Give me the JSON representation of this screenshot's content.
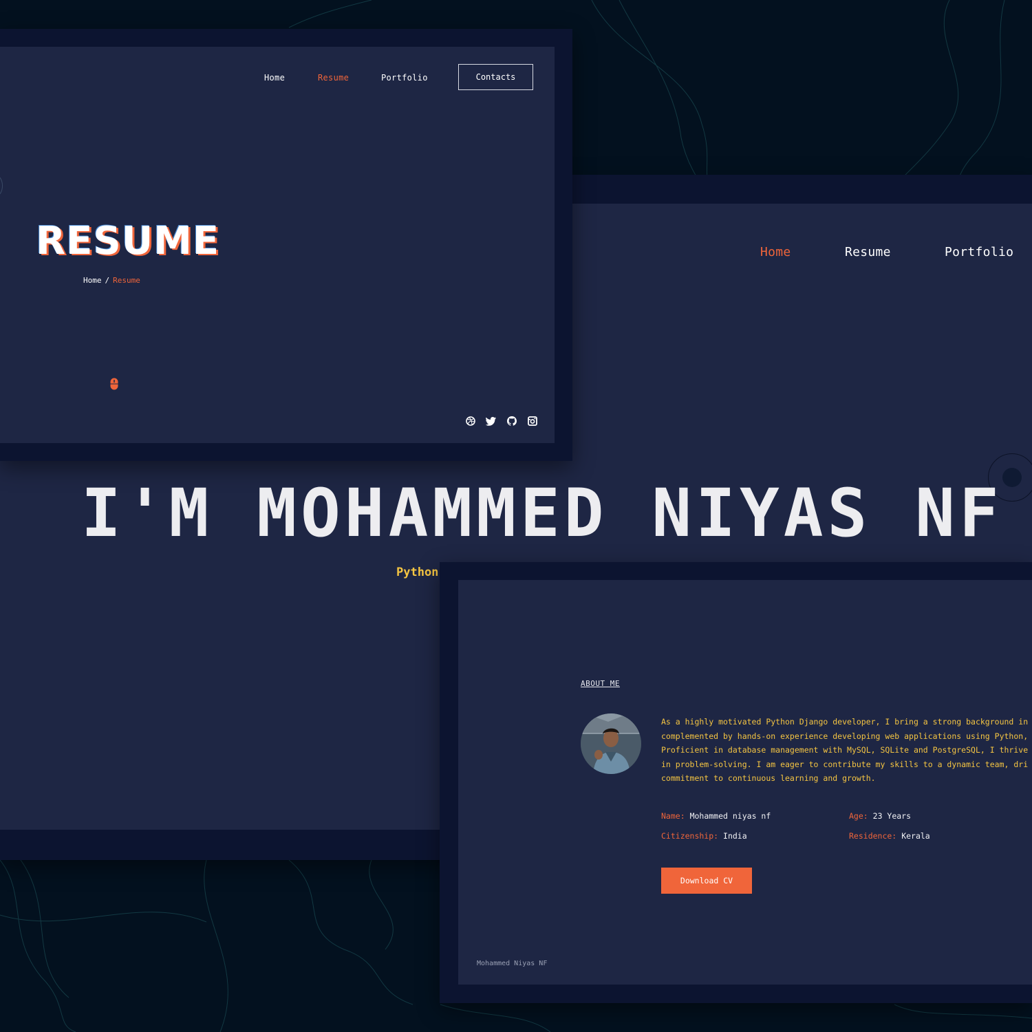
{
  "screen_resume": {
    "nav": [
      "Home",
      "Resume",
      "Portfolio"
    ],
    "contacts": "Contacts",
    "title": "RESUME",
    "breadcrumb": {
      "home": "Home",
      "separator": "/",
      "current": "Resume"
    },
    "social_icons": [
      "dribbble-icon",
      "twitter-icon",
      "github-icon",
      "instagram-icon"
    ]
  },
  "screen_home": {
    "nav": [
      "Home",
      "Resume",
      "Portfolio"
    ],
    "heading": "I'M MOHAMMED NIYAS NF",
    "subtitle": "Python"
  },
  "screen_about": {
    "section_label": "ABOUT ME",
    "paragraph_lines": [
      "As a highly motivated Python Django developer, I bring a strong background in",
      "complemented by hands-on experience developing web applications using Python,",
      "Proficient in database management with MySQL, SQLite and PostgreSQL, I thrive",
      "in problem-solving. I am eager to contribute my skills to a dynamic team, dri",
      "commitment to continuous learning and growth."
    ],
    "info": {
      "name_key": "Name:",
      "name_value": "Mohammed niyas nf",
      "age_key": "Age:",
      "age_value": "23 Years",
      "citizenship_key": "Citizenship:",
      "citizenship_value": "India",
      "residence_key": "Residence:",
      "residence_value": "Kerala"
    },
    "download": "Download CV",
    "footer": "Mohammed Niyas NF"
  },
  "colors": {
    "background": "#03111f",
    "panel": "#1e2644",
    "frame": "#0c1430",
    "accent": "#f0653a",
    "yellow": "#f5c542"
  }
}
